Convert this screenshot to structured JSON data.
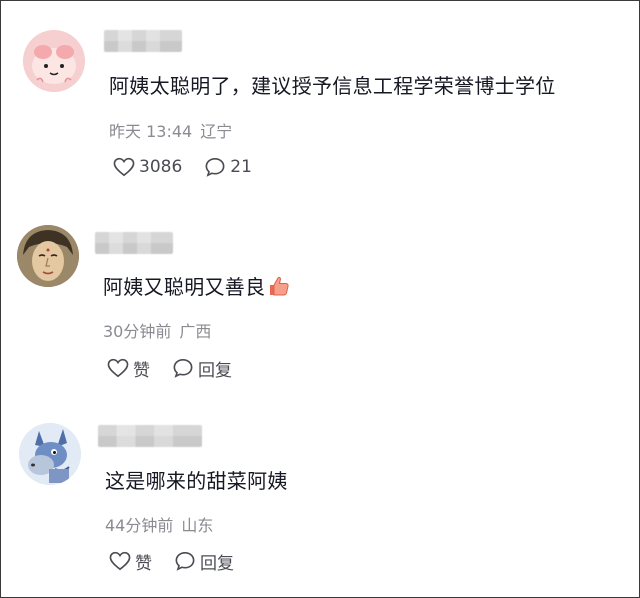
{
  "comments": [
    {
      "text": "阿姨太聪明了，建议授予信息工程学荣誉博士学位",
      "time": "昨天 13:44",
      "location": "辽宁",
      "likes": "3086",
      "replies": "21",
      "avatar": "pink-cartoon-avatar"
    },
    {
      "text": "阿姨又聪明又善良",
      "time": "30分钟前",
      "location": "广西",
      "like_label": "赞",
      "reply_label": "回复",
      "avatar": "statue-face-avatar"
    },
    {
      "text": "这是哪来的甜菜阿姨",
      "time": "44分钟前",
      "location": "山东",
      "like_label": "赞",
      "reply_label": "回复",
      "avatar": "blue-donkey-avatar"
    }
  ],
  "colors": {
    "text": "#161823",
    "meta": "#8a8b91",
    "icon": "#4b4c53",
    "border": "#3a3a3a"
  }
}
